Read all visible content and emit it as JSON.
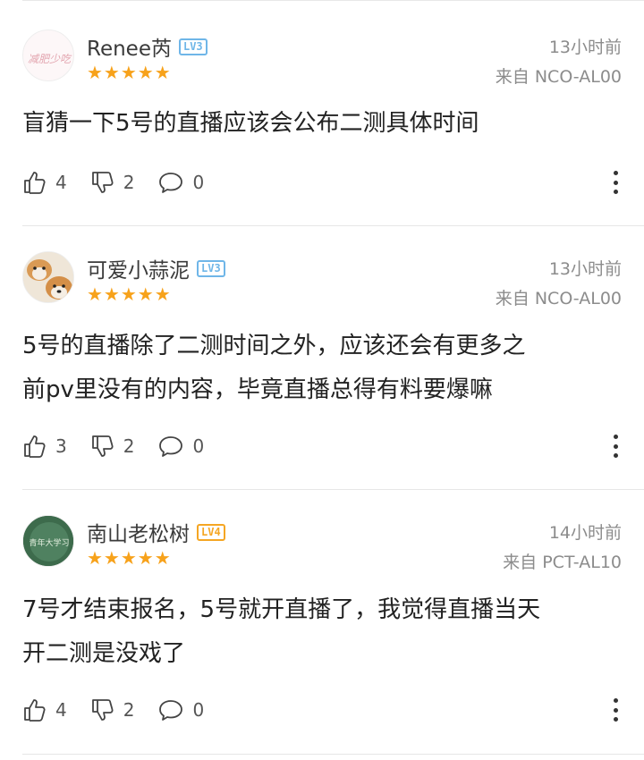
{
  "comments": [
    {
      "username": "Renee芮",
      "level": "LV3",
      "level_color": "#6fb6e8",
      "avatar_text": "减肥少吃",
      "stars": "★★★★★",
      "time": "13小时前",
      "device": "来自 NCO-AL00",
      "content_lines": [
        "盲猜一下5号的直播应该会公布二测具体时间"
      ],
      "likes": "4",
      "dislikes": "2",
      "replies": "0"
    },
    {
      "username": "可爱小蒜泥",
      "level": "LV3",
      "level_color": "#6fb6e8",
      "avatar_icon": "shiba-dogs-avatar",
      "stars": "★★★★★",
      "time": "13小时前",
      "device": "来自 NCO-AL00",
      "content_lines": [
        "5号的直播除了二测时间之外，应该还会有更多之",
        "前pv里没有的内容，毕竟直播总得有料要爆嘛"
      ],
      "likes": "3",
      "dislikes": "2",
      "replies": "0"
    },
    {
      "username": "南山老松树",
      "level": "LV4",
      "level_color": "#f5a623",
      "avatar_text": "青年大学习",
      "stars": "★★★★★",
      "time": "14小时前",
      "device": "来自 PCT-AL10",
      "content_lines": [
        "7号才结束报名，5号就开直播了，我觉得直播当天",
        "开二测是没戏了"
      ],
      "likes": "4",
      "dislikes": "2",
      "replies": "0"
    }
  ],
  "colors": {
    "star": "#f7a21b",
    "meta": "#8c8c8c"
  }
}
